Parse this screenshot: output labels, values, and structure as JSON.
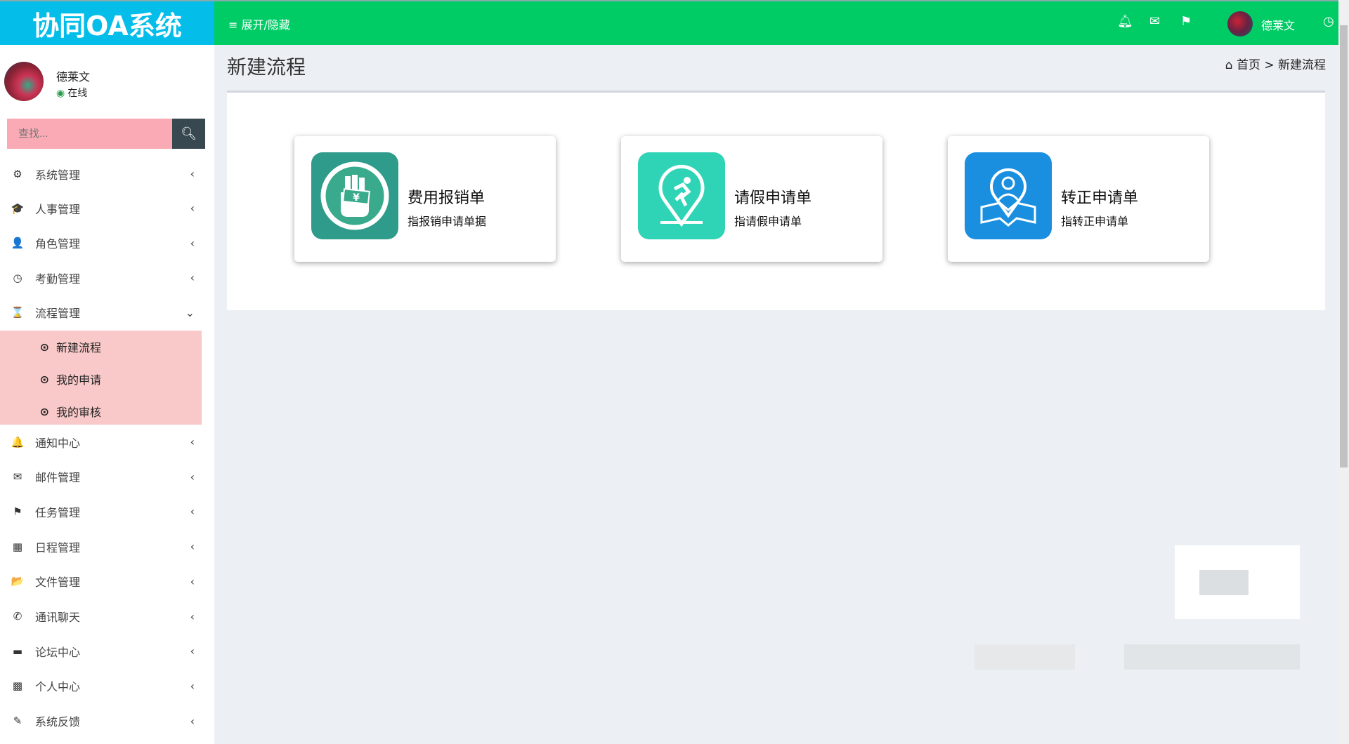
{
  "header": {
    "logo": "协同OA系统",
    "toggle_label": "≡ 展开/隐藏",
    "user_name": "德莱文"
  },
  "sidebar": {
    "user_name": "德莱文",
    "status": "在线",
    "search_placeholder": "查找...",
    "items": [
      {
        "label": "系统管理",
        "icon": "⚙"
      },
      {
        "label": "人事管理",
        "icon": "🎓"
      },
      {
        "label": "角色管理",
        "icon": "👤"
      },
      {
        "label": "考勤管理",
        "icon": "◷"
      },
      {
        "label": "流程管理",
        "icon": "⌛"
      },
      {
        "label": "通知中心",
        "icon": "🔔"
      },
      {
        "label": "邮件管理",
        "icon": "✉"
      },
      {
        "label": "任务管理",
        "icon": "⚑"
      },
      {
        "label": "日程管理",
        "icon": "▦"
      },
      {
        "label": "文件管理",
        "icon": "📂"
      },
      {
        "label": "通讯聊天",
        "icon": "✆"
      },
      {
        "label": "论坛中心",
        "icon": "▬"
      },
      {
        "label": "个人中心",
        "icon": "▩"
      },
      {
        "label": "系统反馈",
        "icon": "✎"
      }
    ],
    "submenu": [
      {
        "label": "新建流程"
      },
      {
        "label": "我的申请"
      },
      {
        "label": "我的审核"
      }
    ]
  },
  "main": {
    "title": "新建流程",
    "breadcrumb": {
      "home": "首页",
      "sep": ">",
      "current": "新建流程"
    },
    "cards": [
      {
        "title": "费用报销单",
        "desc": "指报销申请单据",
        "color": "#2f9b8a"
      },
      {
        "title": "请假申请单",
        "desc": "指请假申请单",
        "color": "#2fd3b5"
      },
      {
        "title": "转正申请单",
        "desc": "指转正申请单",
        "color": "#1a8fe0"
      }
    ]
  }
}
